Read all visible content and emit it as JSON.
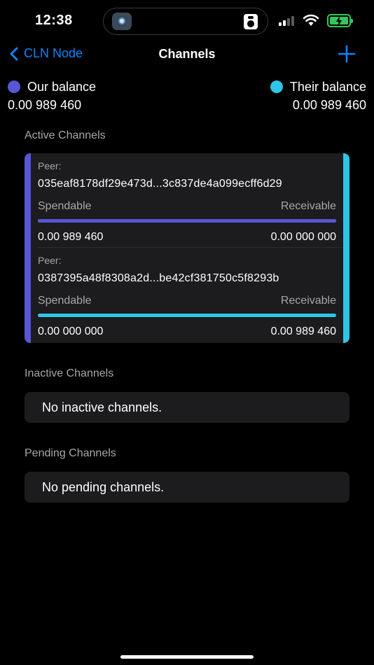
{
  "status_bar": {
    "time": "12:38",
    "battery_color": "#34c759"
  },
  "nav": {
    "back_label": "CLN Node",
    "title": "Channels",
    "accent": "#0a84ff"
  },
  "balances": {
    "ours": {
      "label": "Our balance",
      "amount": "0.00 989 460",
      "color": "#5856d6"
    },
    "theirs": {
      "label": "Their balance",
      "amount": "0.00 989 460",
      "color": "#2ec5e6"
    }
  },
  "active": {
    "title": "Active Channels",
    "channels": [
      {
        "peer_label": "Peer:",
        "peer_id": "035eaf8178df29e473d...3c837de4a099ecff6d29",
        "spendable_label": "Spendable",
        "receivable_label": "Receivable",
        "spendable": "0.00 989 460",
        "receivable": "0.00 000 000",
        "spendable_fraction": 1.0,
        "bar_color": "#5856d6"
      },
      {
        "peer_label": "Peer:",
        "peer_id": "0387395a48f8308a2d...be42cf381750c5f8293b",
        "spendable_label": "Spendable",
        "receivable_label": "Receivable",
        "spendable": "0.00 000 000",
        "receivable": "0.00 989 460",
        "spendable_fraction": 0.0,
        "bar_color": "#2ec5e6"
      }
    ]
  },
  "inactive": {
    "title": "Inactive Channels",
    "empty_text": "No inactive channels."
  },
  "pending": {
    "title": "Pending Channels",
    "empty_text": "No pending channels."
  }
}
